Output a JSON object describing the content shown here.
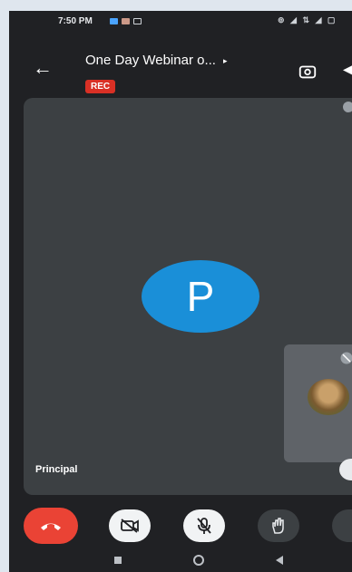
{
  "status_bar": {
    "time": "7:50 PM",
    "icons": [
      "notification-icon",
      "app-icon",
      "signal-icon",
      "wifi-icon",
      "battery-icon"
    ],
    "right_text": "⊚ ◢ ⇅ ◢ ▢"
  },
  "header": {
    "title": "One Day Webinar o...",
    "rec_badge": "REC",
    "back_icon": "back-arrow-icon",
    "camera_switch_icon": "camera-switch-icon"
  },
  "main_tile": {
    "avatar_letter": "P",
    "participant_name": "Principal",
    "avatar_color": "#1a8fd8"
  },
  "controls": {
    "end_call_color": "#ea4335",
    "buttons": [
      "end-call",
      "camera-off",
      "mic-off",
      "raise-hand",
      "more-options"
    ]
  }
}
